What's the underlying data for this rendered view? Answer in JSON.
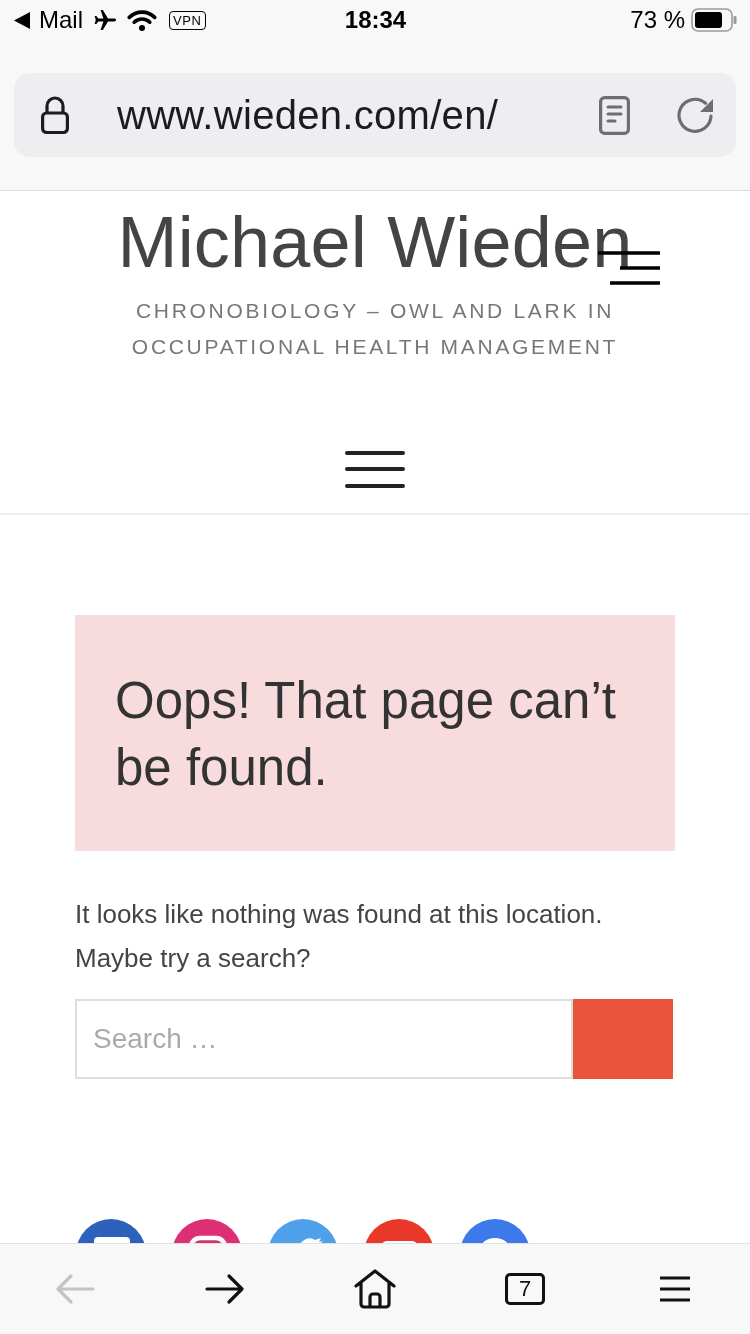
{
  "status_bar": {
    "back_app": "Mail",
    "vpn": "VPN",
    "time": "18:34",
    "battery": "73 %"
  },
  "browser": {
    "url": "www.wieden.com/en/"
  },
  "site_header": {
    "title": "Michael Wieden",
    "tagline": "CHRONOBIOLOGY – OWL AND LARK IN OCCUPATIONAL HEALTH MANAGEMENT"
  },
  "error": {
    "heading": "Oops! That page can’t be found.",
    "message": "It looks like nothing was found at this location. Maybe try a search?"
  },
  "search": {
    "placeholder": "Search …"
  },
  "social_links": [
    {
      "kind": "square",
      "color": "#2c62bb"
    },
    {
      "kind": "ring-square",
      "color": "#de2f74"
    },
    {
      "kind": "bird",
      "color": "#4fa0eb"
    },
    {
      "kind": "wide-rect",
      "color": "#e9382a"
    },
    {
      "kind": "circle",
      "color": "#3c79e9"
    }
  ],
  "toolbar": [
    {
      "kind": "back",
      "disabled": true
    },
    {
      "kind": "forward",
      "disabled": false
    },
    {
      "kind": "home",
      "disabled": false
    },
    {
      "kind": "tabs",
      "count": "7",
      "disabled": false
    },
    {
      "kind": "menu",
      "disabled": false
    }
  ]
}
